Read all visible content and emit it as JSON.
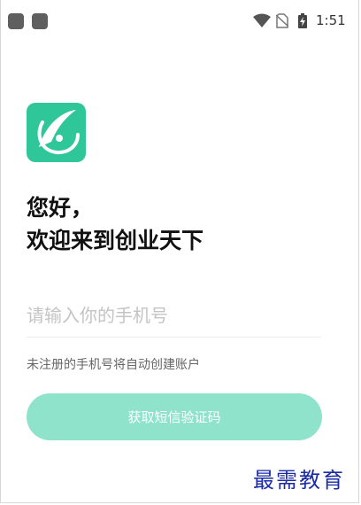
{
  "status_bar": {
    "time": "1:51",
    "icons": [
      "app-icon",
      "app-icon",
      "wifi-icon",
      "no-sim-icon",
      "battery-charging-icon"
    ]
  },
  "app": {
    "logo_icon": "app-logo-icon",
    "brand_color": "#2fc79a"
  },
  "greeting": {
    "line1": "您好，",
    "line2": "欢迎来到创业天下"
  },
  "login": {
    "phone_placeholder": "请输入你的手机号",
    "hint": "未注册的手机号将自动创建账户",
    "button_label": "获取短信验证码",
    "button_color": "#8fe3ca"
  },
  "watermark": "最需教育"
}
